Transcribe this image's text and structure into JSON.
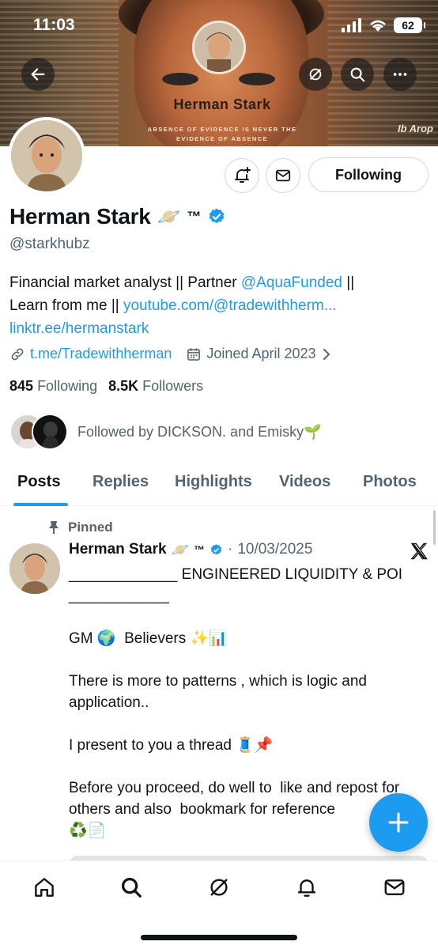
{
  "status_bar": {
    "time": "11:03",
    "battery": "62"
  },
  "banner": {
    "name": "Herman Stark",
    "tagline": "ABSENCE OF EVIDENCE IS NEVER THE EVIDENCE OF ABSENCE",
    "stamp": "Ib Arop"
  },
  "profile": {
    "display_name": "Herman Stark",
    "name_emoji": "🪐",
    "trademark": "™",
    "handle": "@starkhubz",
    "bio": {
      "line1_text": "Financial market analyst || Partner ",
      "line1_link": "@AquaFunded",
      "line1_end": " ||",
      "line2_text": "Learn from me || ",
      "line2_link": "youtube.com/@tradewithherm...",
      "line3_link": "linktr.ee/hermanstark"
    },
    "website": "t.me/Tradewithherman",
    "joined": "Joined April 2023",
    "following_count": "845",
    "following_label": "Following",
    "followers_count": "8.5K",
    "followers_label": "Followers",
    "followed_by": "Followed by DICKSON. and Emisky🌱",
    "follow_button": "Following"
  },
  "tabs": [
    "Posts",
    "Replies",
    "Highlights",
    "Videos",
    "Photos"
  ],
  "post": {
    "pinned_label": "Pinned",
    "author": "Herman Stark",
    "author_emoji": "🪐",
    "trademark": "™",
    "separator": "·",
    "date": "10/03/2025",
    "body": "_____________ ENGINEERED LIQUIDITY & POI\n____________\n\nGM 🌍  Believers ✨📊\n\nThere is more to patterns , which is logic and application..\n\nI present to you a thread 🧵📌\n\nBefore you proceed, do well to  like and repost for others and also  bookmark for reference\n♻️📄"
  },
  "colors": {
    "accent": "#1d9bf0",
    "text": "#0f1419",
    "secondary": "#536471",
    "border": "#cfd9de"
  },
  "icons": {
    "top_bar": [
      "back-arrow-icon",
      "grok-icon",
      "search-icon",
      "more-icon"
    ],
    "profile_actions": [
      "notification-bell-plus-icon",
      "mail-icon"
    ],
    "nav": [
      "home-icon",
      "search-icon",
      "grok-icon",
      "notifications-icon",
      "messages-icon"
    ],
    "fab": "plus-icon"
  }
}
